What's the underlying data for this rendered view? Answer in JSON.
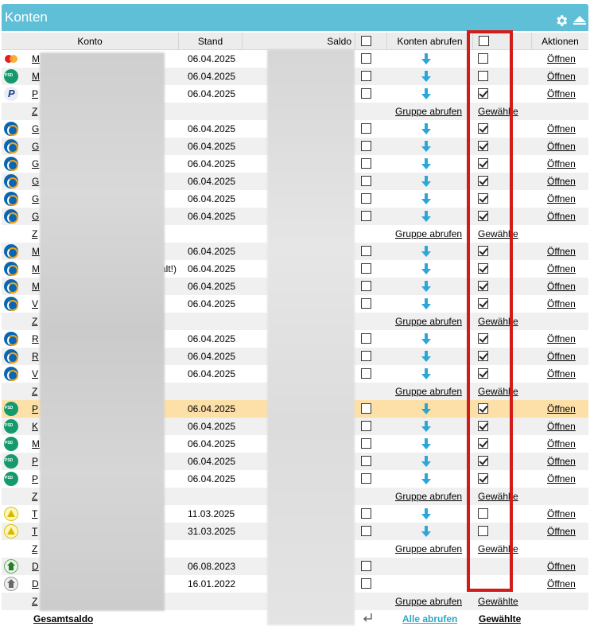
{
  "title": "Konten",
  "header": {
    "konto": "Konto",
    "stand": "Stand",
    "saldo": "Saldo",
    "fetch": "Konten abrufen",
    "actions": "Aktionen"
  },
  "labels": {
    "group_fetch": "Gruppe abrufen",
    "selected": "Gewählte",
    "open": "Öffnen",
    "group_prefix": "Z"
  },
  "rows": [
    {
      "type": "acct",
      "icon": "mastercard-icon",
      "name": "M",
      "stand": "06.04.2025",
      "fetch": true,
      "sel": false
    },
    {
      "type": "acct",
      "icon": "psd-bank-icon",
      "name": "M",
      "stand": "06.04.2025",
      "fetch": true,
      "sel": false
    },
    {
      "type": "acct",
      "icon": "paypal-icon",
      "name": "P",
      "stand": "06.04.2025",
      "fetch": true,
      "sel": true
    },
    {
      "type": "group",
      "name": "Z"
    },
    {
      "type": "acct",
      "icon": "volksbank-icon",
      "name": "G",
      "stand": "06.04.2025",
      "fetch": true,
      "sel": true
    },
    {
      "type": "acct",
      "icon": "volksbank-icon",
      "name": "G",
      "stand": "06.04.2025",
      "fetch": true,
      "sel": true
    },
    {
      "type": "acct",
      "icon": "volksbank-icon",
      "name": "G",
      "stand": "06.04.2025",
      "fetch": true,
      "sel": true
    },
    {
      "type": "acct",
      "icon": "volksbank-icon",
      "name": "G",
      "stand": "06.04.2025",
      "fetch": true,
      "sel": true
    },
    {
      "type": "acct",
      "icon": "volksbank-icon",
      "name": "G",
      "stand": "06.04.2025",
      "fetch": true,
      "sel": true
    },
    {
      "type": "acct",
      "icon": "volksbank-icon",
      "name": "G",
      "stand": "06.04.2025",
      "fetch": true,
      "sel": true
    },
    {
      "type": "group",
      "name": "Z"
    },
    {
      "type": "acct",
      "icon": "volksbank-icon",
      "name": "M",
      "stand": "06.04.2025",
      "fetch": true,
      "sel": true
    },
    {
      "type": "acct",
      "icon": "volksbank-icon",
      "name": "M",
      "suffix": "alt!)",
      "stand": "06.04.2025",
      "fetch": true,
      "sel": true
    },
    {
      "type": "acct",
      "icon": "volksbank-icon",
      "name": "M",
      "stand": "06.04.2025",
      "fetch": true,
      "sel": true
    },
    {
      "type": "acct",
      "icon": "volksbank-icon",
      "name": "V",
      "stand": "06.04.2025",
      "fetch": true,
      "sel": true
    },
    {
      "type": "group",
      "name": "Z"
    },
    {
      "type": "acct",
      "icon": "volksbank-icon",
      "name": "R",
      "stand": "06.04.2025",
      "fetch": true,
      "sel": true
    },
    {
      "type": "acct",
      "icon": "volksbank-icon",
      "name": "R",
      "stand": "06.04.2025",
      "fetch": true,
      "sel": true
    },
    {
      "type": "acct",
      "icon": "volksbank-icon",
      "name": "V",
      "stand": "06.04.2025",
      "fetch": true,
      "sel": true
    },
    {
      "type": "group",
      "name": "Z"
    },
    {
      "type": "acct",
      "icon": "psd-bank-icon",
      "name": "P",
      "stand": "06.04.2025",
      "fetch": true,
      "sel": true,
      "highlight": true
    },
    {
      "type": "acct",
      "icon": "psd-bank-icon",
      "name": "K",
      "stand": "06.04.2025",
      "fetch": true,
      "sel": true
    },
    {
      "type": "acct",
      "icon": "psd-bank-icon",
      "name": "M",
      "stand": "06.04.2025",
      "fetch": true,
      "sel": true
    },
    {
      "type": "acct",
      "icon": "psd-bank-icon",
      "name": "P",
      "stand": "06.04.2025",
      "fetch": true,
      "sel": true
    },
    {
      "type": "acct",
      "icon": "psd-bank-icon",
      "name": "P",
      "stand": "06.04.2025",
      "fetch": true,
      "sel": true
    },
    {
      "type": "group",
      "name": "Z"
    },
    {
      "type": "acct",
      "icon": "triangle-bank-icon",
      "name": "T",
      "stand": "11.03.2025",
      "fetch": true,
      "sel": false
    },
    {
      "type": "acct",
      "icon": "triangle-bank-icon",
      "name": "T",
      "stand": "31.03.2025",
      "fetch": true,
      "sel": false
    },
    {
      "type": "group",
      "name": "Z"
    },
    {
      "type": "acct",
      "icon": "house-green-icon",
      "name": "D",
      "stand": "06.08.2023",
      "fetch": false,
      "sel": null
    },
    {
      "type": "acct",
      "icon": "house-gray-icon",
      "name": "D",
      "stand": "16.01.2022",
      "fetch": false,
      "sel": null
    },
    {
      "type": "group",
      "name": "Z"
    }
  ],
  "footer": {
    "total": "Gesamtsaldo",
    "fetch_all": "Alle abrufen",
    "selected": "Gewählte"
  }
}
